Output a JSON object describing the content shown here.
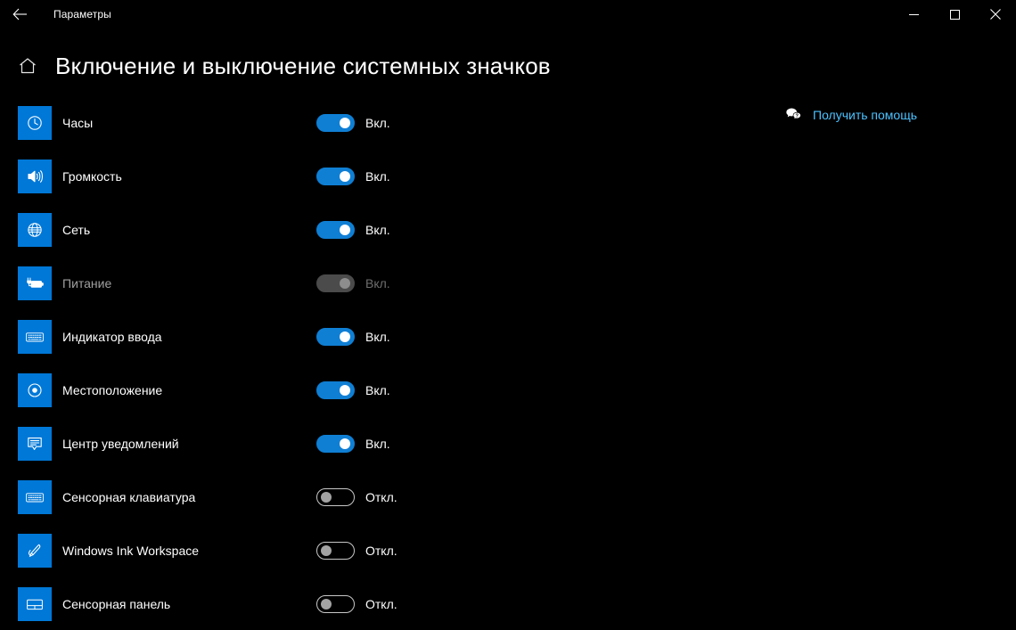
{
  "window": {
    "app_title": "Параметры",
    "back_icon": "back-arrow-icon",
    "minimize_icon": "minimize-icon",
    "maximize_icon": "maximize-icon",
    "close_icon": "close-icon"
  },
  "header": {
    "home_icon": "home-icon",
    "page_title": "Включение и выключение системных значков"
  },
  "help": {
    "icon": "help-chat-icon",
    "label": "Получить помощь"
  },
  "labels": {
    "on": "Вкл.",
    "off": "Откл."
  },
  "colors": {
    "accent": "#0078d7",
    "toggle_on": "#0f7fd4",
    "link": "#4cc2ff",
    "background": "#000000",
    "disabled_text": "#6e6e6e"
  },
  "settings": [
    {
      "name": "Часы",
      "icon": "clock-icon",
      "state": "on",
      "state_label": "Вкл.",
      "enabled": true
    },
    {
      "name": "Громкость",
      "icon": "volume-icon",
      "state": "on",
      "state_label": "Вкл.",
      "enabled": true
    },
    {
      "name": "Сеть",
      "icon": "network-globe-icon",
      "state": "on",
      "state_label": "Вкл.",
      "enabled": true
    },
    {
      "name": "Питание",
      "icon": "battery-power-icon",
      "state": "on",
      "state_label": "Вкл.",
      "enabled": false
    },
    {
      "name": "Индикатор ввода",
      "icon": "keyboard-icon",
      "state": "on",
      "state_label": "Вкл.",
      "enabled": true
    },
    {
      "name": "Местоположение",
      "icon": "location-icon",
      "state": "on",
      "state_label": "Вкл.",
      "enabled": true
    },
    {
      "name": "Центр уведомлений",
      "icon": "notification-icon",
      "state": "on",
      "state_label": "Вкл.",
      "enabled": true
    },
    {
      "name": "Сенсорная клавиатура",
      "icon": "touch-keyboard-icon",
      "state": "off",
      "state_label": "Откл.",
      "enabled": true
    },
    {
      "name": "Windows Ink Workspace",
      "icon": "pen-ink-icon",
      "state": "off",
      "state_label": "Откл.",
      "enabled": true
    },
    {
      "name": "Сенсорная панель",
      "icon": "touchpad-icon",
      "state": "off",
      "state_label": "Откл.",
      "enabled": true
    }
  ]
}
